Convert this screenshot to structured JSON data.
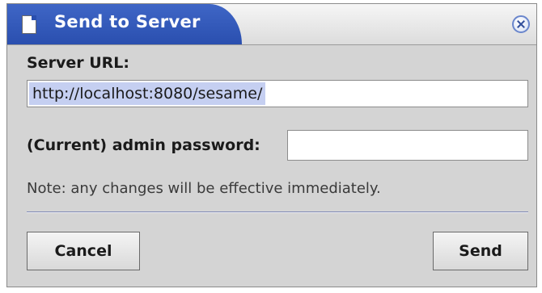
{
  "window": {
    "title": "Send to Server"
  },
  "form": {
    "server_url_label": "Server URL:",
    "server_url_value": "http://localhost:8080/sesame/",
    "password_label": "(Current) admin password:",
    "password_value": "",
    "note": "Note: any changes will be effective immediately."
  },
  "buttons": {
    "cancel_label": "Cancel",
    "send_label": "Send"
  },
  "icons": {
    "window_icon": "document-icon",
    "close_icon": "close-icon"
  },
  "colors": {
    "titlebar_accent": "#2a4faf",
    "selection_highlight": "#c5cff1",
    "dialog_background": "#d4d4d4"
  }
}
